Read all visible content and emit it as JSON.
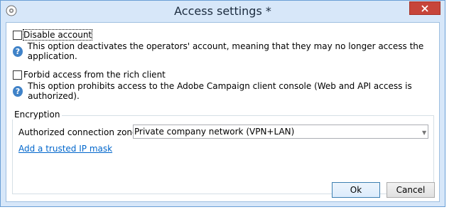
{
  "window": {
    "title": "Access settings *"
  },
  "options": [
    {
      "label": "Disable account",
      "checked": false,
      "help": "This option deactivates the operators' account, meaning that they may no longer access the application."
    },
    {
      "label": "Forbid access from the rich client",
      "checked": false,
      "help": "This option prohibits access to the Adobe Campaign client console (Web and API access is authorized)."
    }
  ],
  "encryption": {
    "legend": "Encryption",
    "zone_label": "Authorized connection zone:",
    "zone_value": "Private company network (VPN+LAN)",
    "add_mask_link": "Add a trusted IP mask"
  },
  "buttons": {
    "ok": "Ok",
    "cancel": "Cancel"
  },
  "icons": {
    "app": "app-icon",
    "close": "close-icon",
    "help": "help-icon",
    "dropdown": "dropdown-arrow-icon"
  },
  "colors": {
    "close_bg": "#c7453a",
    "help_icon": "#3f82c8",
    "link": "#0066cc",
    "frame": "#d7e7f9"
  }
}
